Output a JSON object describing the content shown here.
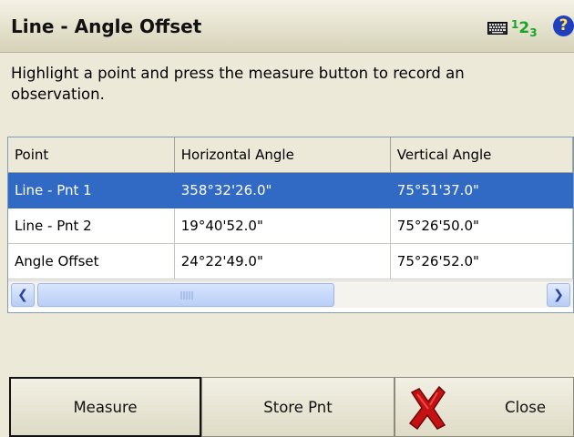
{
  "window": {
    "title": "Line - Angle Offset",
    "icons": [
      "keyboard-icon",
      "numeric-input-icon",
      "help-icon"
    ],
    "numeric_icon": {
      "one": "1",
      "two": "2",
      "three": "3"
    },
    "help_glyph": "?"
  },
  "instruction": "Highlight a point and press the measure button to record an observation.",
  "table": {
    "columns": [
      "Point",
      "Horizontal Angle",
      "Vertical Angle"
    ],
    "rows": [
      {
        "point": "Line - Pnt 1",
        "horizontal": "358°32'26.0\"",
        "vertical": "75°51'37.0\"",
        "selected": true
      },
      {
        "point": "Line - Pnt 2",
        "horizontal": "19°40'52.0\"",
        "vertical": "75°26'50.0\"",
        "selected": false
      },
      {
        "point": "Angle Offset",
        "horizontal": "24°22'49.0\"",
        "vertical": "75°26'52.0\"",
        "selected": false
      }
    ]
  },
  "buttons": {
    "measure": "Measure",
    "store": "Store Pnt",
    "close": "Close"
  },
  "colors": {
    "selection": "#316ac5",
    "background": "#ece9d8",
    "help": "#1f3fbf",
    "numeric": "#1aa32a",
    "close_x": "#c41212"
  }
}
